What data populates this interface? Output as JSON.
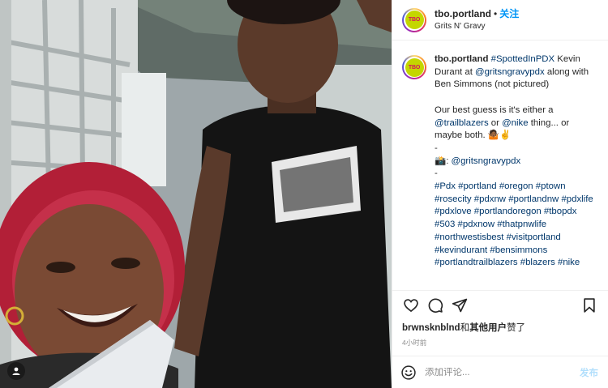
{
  "header": {
    "username": "tbo.portland",
    "separator": "•",
    "follow_label": "关注",
    "location": "Grits N' Gravy",
    "avatar_text": "TBO"
  },
  "caption": {
    "username": "tbo.portland",
    "hashtag1": "#SpottedInPDX",
    "text1": " Kevin Durant at ",
    "mention1": "@gritsngravypdx",
    "text2": " along with Ben Simmons (not pictured)",
    "text3": "Our best guess is it's either a ",
    "mention2": "@trailblazers",
    "text4": " or ",
    "mention3": "@nike",
    "text5": " thing... or maybe both. ",
    "emoji1": "🤷🏾✌️",
    "dash1": "-",
    "camera_emoji": "📸",
    "credit_sep": ": ",
    "mention4": "@gritsngravypdx",
    "dash2": "-",
    "hashtags": [
      "#Pdx",
      "#portland",
      "#oregon",
      "#ptown",
      "#rosecity",
      "#pdxnw",
      "#portlandnw",
      "#pdxlife",
      "#pdxlove",
      "#portlandoregon",
      "#tbopdx",
      "#503",
      "#pdxnow",
      "#thatpnwlife",
      "#northwestisbest",
      "#visitportland",
      "#kevindurant",
      "#bensimmons",
      "#portlandtrailblazers",
      "#blazers",
      "#nike"
    ]
  },
  "actions": {
    "like_icon": "heart-icon",
    "comment_icon": "comment-icon",
    "share_icon": "share-icon",
    "save_icon": "bookmark-icon"
  },
  "likes": {
    "user": "brwnsknblnd",
    "connector": "和",
    "others": "其他用户",
    "suffix": "赞了"
  },
  "timestamp": "4小时前",
  "comment": {
    "placeholder": "添加评论...",
    "post_label": "发布",
    "emoji_icon": "smiley-icon"
  },
  "colors": {
    "link": "#00376b",
    "follow": "#0095f6",
    "post_disabled": "#b2dffc",
    "logo_bg": "#c4d600",
    "logo_text": "#d4145a"
  }
}
